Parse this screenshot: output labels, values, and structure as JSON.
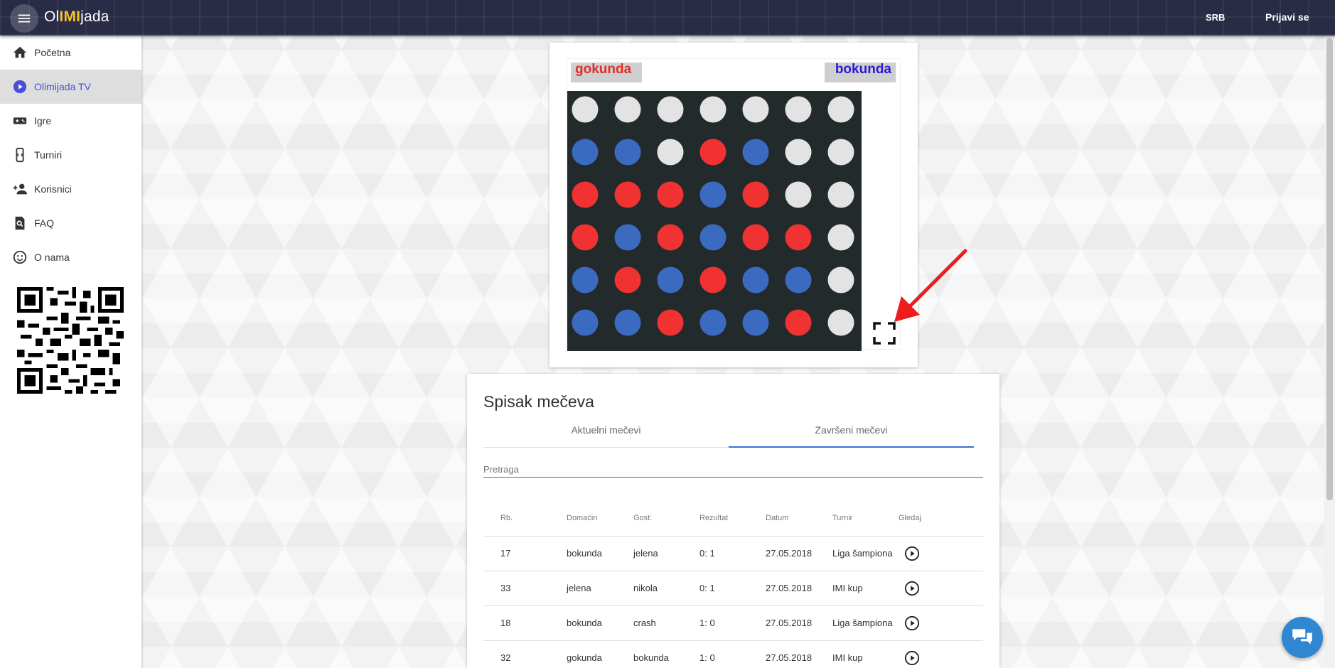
{
  "header": {
    "logo_prefix": "Ol",
    "logo_highlight": "IMI",
    "logo_suffix": "jada",
    "language": "SRB",
    "login_label": "Prijavi se"
  },
  "sidebar": {
    "items": [
      {
        "label": "Početna",
        "icon": "home-icon"
      },
      {
        "label": "Olimijada TV",
        "icon": "play-circle-icon",
        "active": true
      },
      {
        "label": "Igre",
        "icon": "gamepad-icon"
      },
      {
        "label": "Turniri",
        "icon": "phone-code-icon"
      },
      {
        "label": "Korisnici",
        "icon": "add-user-icon"
      },
      {
        "label": "FAQ",
        "icon": "search-doc-icon"
      },
      {
        "label": "O nama",
        "icon": "smiley-icon"
      }
    ]
  },
  "game": {
    "player_left": "gokunda",
    "player_right": "bokunda",
    "colors": {
      "board": "#222a2c",
      "red": "#f03232",
      "blue": "#3a6bc0",
      "empty": "#e3e3e3"
    },
    "board": [
      [
        "E",
        "E",
        "E",
        "E",
        "E",
        "E",
        "E"
      ],
      [
        "B",
        "B",
        "E",
        "R",
        "B",
        "E",
        "E"
      ],
      [
        "R",
        "R",
        "R",
        "B",
        "R",
        "E",
        "E"
      ],
      [
        "R",
        "B",
        "R",
        "B",
        "R",
        "R",
        "E"
      ],
      [
        "B",
        "R",
        "B",
        "R",
        "B",
        "B",
        "E"
      ],
      [
        "B",
        "B",
        "R",
        "B",
        "B",
        "R",
        "E"
      ]
    ]
  },
  "matches": {
    "title": "Spisak mečeva",
    "tabs": [
      "Aktuelni mečevi",
      "Završeni mečevi"
    ],
    "active_tab": 1,
    "search_placeholder": "Pretraga",
    "columns": [
      "Rb.",
      "Domaćin",
      "Gost:",
      "Rezultat",
      "Datum",
      "Turnir",
      "Gledaj"
    ],
    "rows": [
      {
        "rb": "17",
        "home": "bokunda",
        "guest": "jelena",
        "result": "0: 1",
        "date": "27.05.2018",
        "tournament": "Liga šampiona"
      },
      {
        "rb": "33",
        "home": "jelena",
        "guest": "nikola",
        "result": "0: 1",
        "date": "27.05.2018",
        "tournament": "IMI kup"
      },
      {
        "rb": "18",
        "home": "bokunda",
        "guest": "crash",
        "result": "1: 0",
        "date": "27.05.2018",
        "tournament": "Liga šampiona"
      },
      {
        "rb": "32",
        "home": "gokunda",
        "guest": "bokunda",
        "result": "1: 0",
        "date": "27.05.2018",
        "tournament": "IMI kup"
      }
    ]
  },
  "accent_color": "#3b6fd4"
}
